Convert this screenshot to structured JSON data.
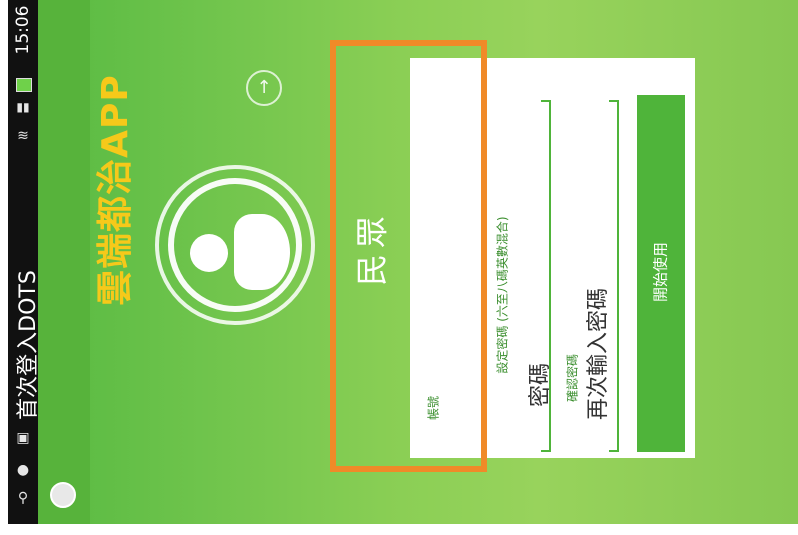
{
  "status_bar": {
    "time": "15:06",
    "icons": [
      "usb-icon",
      "app-icon",
      "image-icon",
      "wifi-icon",
      "signal-icon",
      "battery-icon"
    ]
  },
  "action_bar": {
    "title": "首次登入DOTS"
  },
  "app_name": "雲端都治APP",
  "role_label": "民眾",
  "form": {
    "account_label": "帳號",
    "password_label": "設定密碼 (六至八碼英數混合)",
    "password_placeholder": "密碼",
    "confirm_label": "確認密碼",
    "confirm_placeholder": "再次輸入密碼",
    "start_button": "開始使用"
  },
  "colors": {
    "accent_green": "#4fb43a",
    "title_yellow": "#f6c91a",
    "highlight_orange": "#f08a28"
  }
}
